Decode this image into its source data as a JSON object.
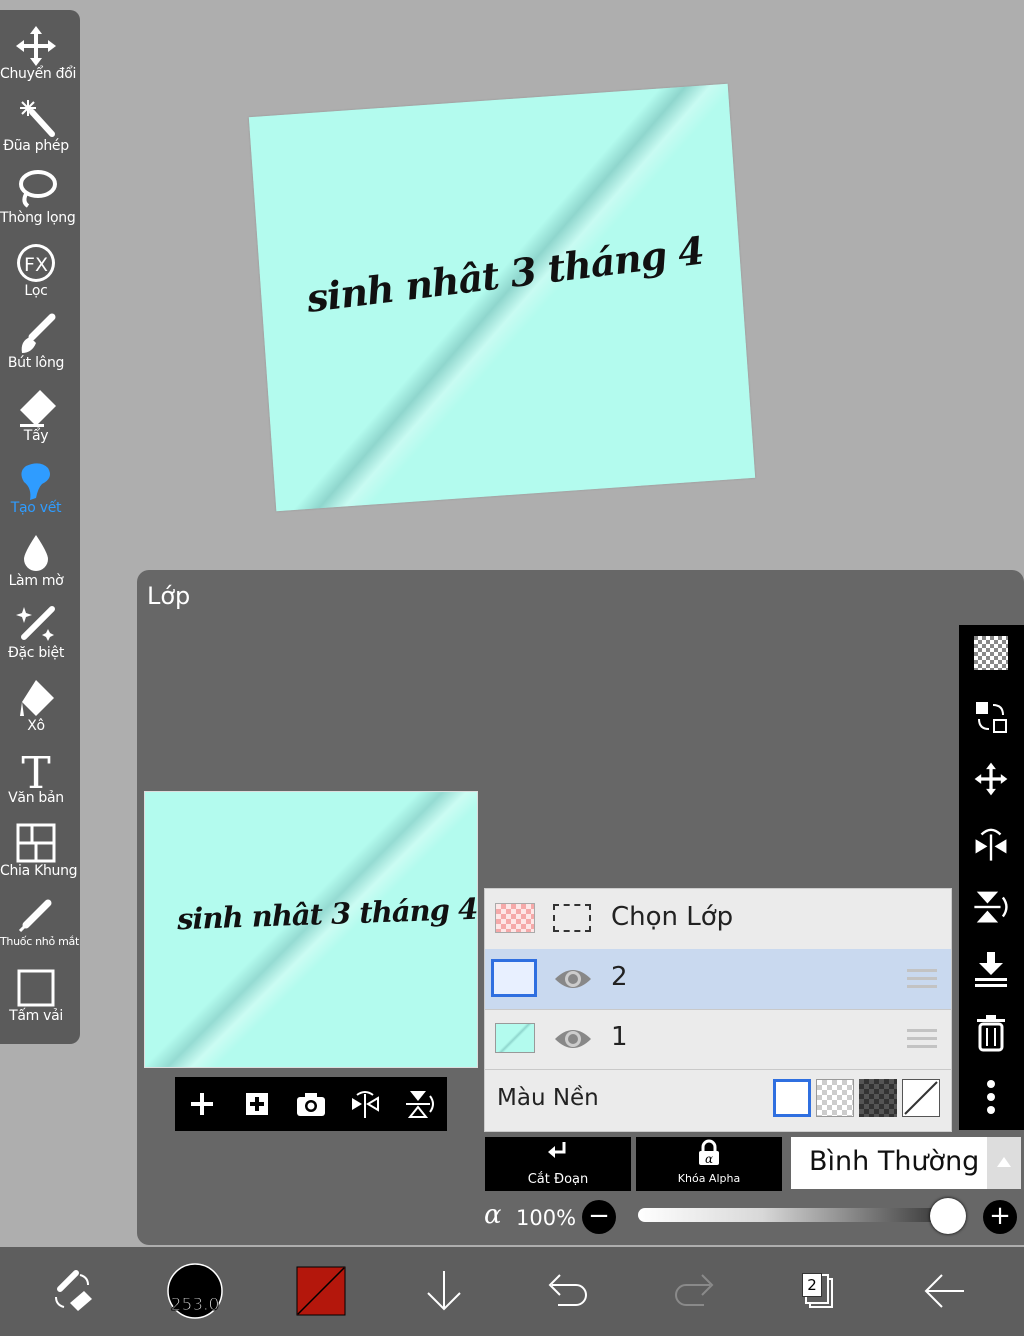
{
  "canvas": {
    "text": "sinh nhât 3 tháng 4"
  },
  "tools": [
    {
      "label": "Chuyển đổi",
      "icon": "move-icon"
    },
    {
      "label": "Đũa phép",
      "icon": "magic-wand-icon"
    },
    {
      "label": "Thòng lọng",
      "icon": "lasso-icon"
    },
    {
      "label": "Lọc",
      "icon": "fx-filter-icon"
    },
    {
      "label": "Bút lông",
      "icon": "brush-icon"
    },
    {
      "label": "Tẩy",
      "icon": "eraser-icon"
    },
    {
      "label": "Tạo vết",
      "icon": "smudge-icon",
      "active": true
    },
    {
      "label": "Làm mờ",
      "icon": "blur-drop-icon"
    },
    {
      "label": "Đặc biệt",
      "icon": "special-pen-icon"
    },
    {
      "label": "Xô",
      "icon": "bucket-icon"
    },
    {
      "label": "Văn bản",
      "icon": "text-icon"
    },
    {
      "label": "Chia Khung",
      "icon": "frame-divider-icon"
    },
    {
      "label": "Thuốc nhỏ mắt",
      "icon": "eyedropper-icon"
    },
    {
      "label": "Tấm vải",
      "icon": "canvas-icon"
    }
  ],
  "layer_panel": {
    "title": "Lớp",
    "thumbnail_text": "sinh nhât 3 tháng 4",
    "select_layer_label": "Chọn Lớp",
    "layers": [
      {
        "name": "2",
        "selected": true
      },
      {
        "name": "1",
        "selected": false
      }
    ],
    "background_label": "Màu Nền",
    "cut_label": "Cắt Đoạn",
    "alpha_lock_label": "Khóa Alpha",
    "blend_mode": "Bình Thường",
    "opacity_symbol": "α",
    "opacity_value": "100%",
    "opacity_level": 1.0,
    "minus_label": "−",
    "plus_label": "+"
  },
  "bottom_bar": {
    "brush_size": "253.0",
    "layer_count": "2",
    "color_swatch": "#b4170c"
  },
  "colors": {
    "panel_bg": "#676767",
    "toolbar_bg": "#5b5b5b",
    "accent_active": "#2f9cff",
    "canvas_cyan": "#b3fbee",
    "selected_row": "#c9d9ef"
  }
}
